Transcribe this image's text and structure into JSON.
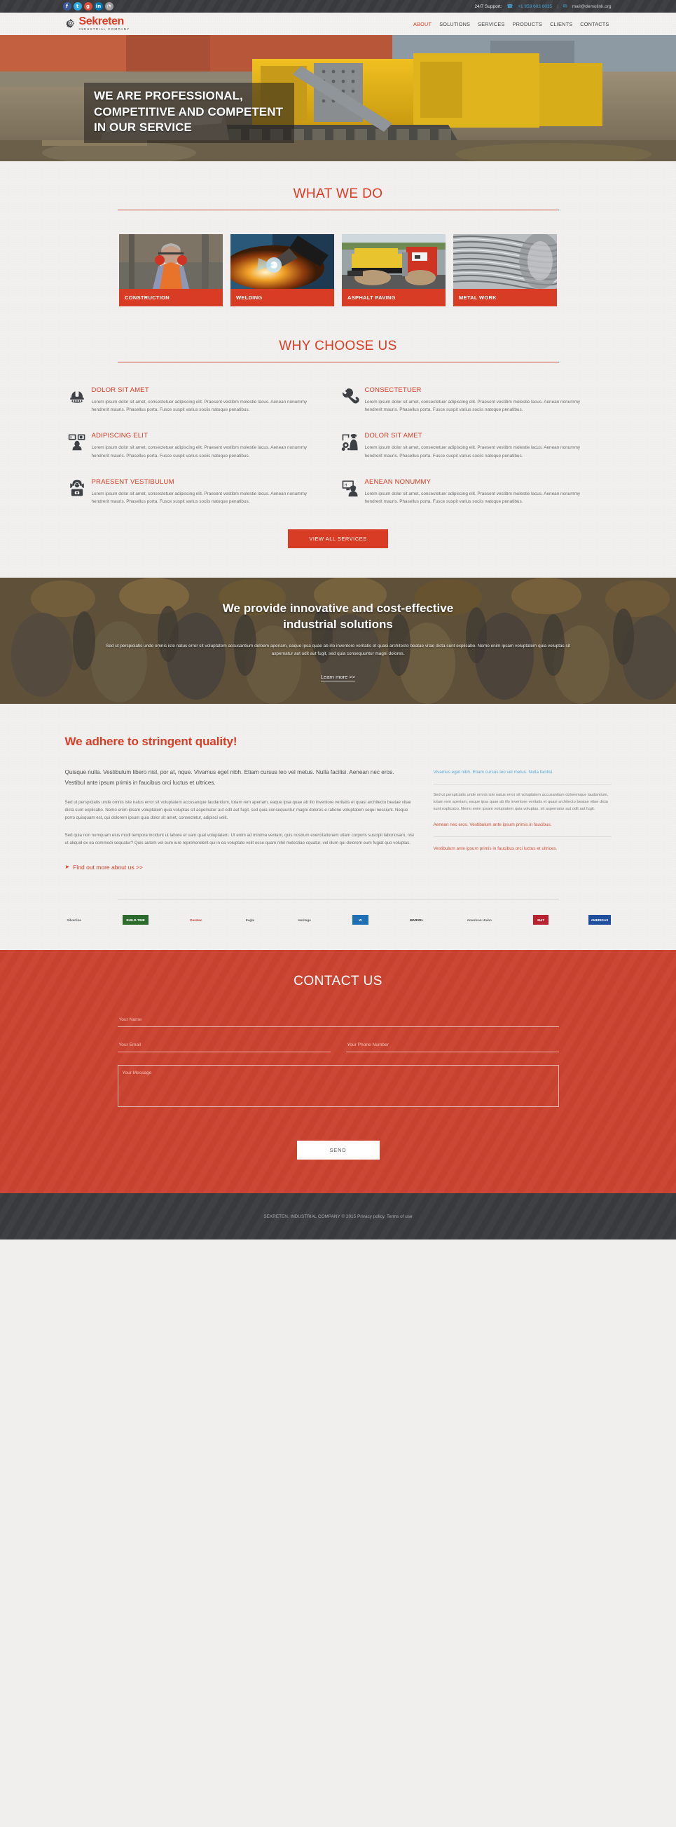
{
  "topbar": {
    "social": [
      {
        "name": "facebook",
        "glyph": "f"
      },
      {
        "name": "twitter",
        "glyph": "t"
      },
      {
        "name": "google-plus",
        "glyph": "g"
      },
      {
        "name": "linkedin",
        "glyph": "in"
      },
      {
        "name": "rss",
        "glyph": "◔"
      }
    ],
    "support_label": "24/7 Support:",
    "phone": "+1 959 603 6035",
    "separator": "|",
    "email": "mail@demolink.org"
  },
  "header": {
    "logo_name": "Sekreten",
    "logo_sub": "INDUSTRIAL COMPANY",
    "nav": [
      {
        "label": "ABOUT",
        "active": true
      },
      {
        "label": "SOLUTIONS",
        "active": false
      },
      {
        "label": "SERVICES",
        "active": false
      },
      {
        "label": "PRODUCTS",
        "active": false
      },
      {
        "label": "CLIENTS",
        "active": false
      },
      {
        "label": "CONTACTS",
        "active": false
      }
    ]
  },
  "hero": {
    "line1": "WE ARE PROFESSIONAL,",
    "line2": "COMPETITIVE AND COMPETENT",
    "line3": "IN OUR SERVICE"
  },
  "what_we_do": {
    "title": "WHAT WE DO",
    "cards": [
      {
        "label": "CONSTRUCTION"
      },
      {
        "label": "WELDING"
      },
      {
        "label": "ASPHALT PAVING"
      },
      {
        "label": "METAL WORK"
      }
    ]
  },
  "why_choose_us": {
    "title": "WHY CHOOSE US",
    "body": "Lorem ipsum dolor sit amet, consectetuer adipiscing elit. Praesent vestibm molestie lacus. Aenean nonummy hendrerit mauris. Phasellus porta. Fusce suspit varius sociis natoque penatibus.",
    "features": [
      {
        "title": "DOLOR SIT AMET",
        "icon": "hard-hat-icon"
      },
      {
        "title": "CONSECTETUER",
        "icon": "wrench-icon"
      },
      {
        "title": "ADIPISCING ELIT",
        "icon": "monitor-worker-icon"
      },
      {
        "title": "DOLOR SIT AMET",
        "icon": "crane-worker-icon"
      },
      {
        "title": "PRAESENT VESTIBULUM",
        "icon": "worker-laptop-icon"
      },
      {
        "title": "AENEAN NONUMMY",
        "icon": "screen-worker-icon"
      }
    ],
    "button": "VIEW ALL SERVICES"
  },
  "parallax": {
    "heading_line1": "We provide innovative and cost-effective",
    "heading_line2": "industrial solutions",
    "text": "Sed ut perspiciatis unde omnis iste natus error sit voluptatem accusantium doloem aperiam, eaque ipsa quae ab illo inventore veritatis et quasi architecto beatae vitae dicta sunt explicabo. Nemo enim ipsam voluptatem quia voluptas sit aspernatur aut odit aut fugit, sed quia consequuntur magni dolores.",
    "link": "Learn more >>"
  },
  "quality": {
    "heading": "We adhere to stringent quality!",
    "lead": "Quisque nulla. Vestibulum libero nisl, por at, nque. Vivamus eget nibh. Etiam cursus leo vel metus. Nulla facilisi. Aenean nec eros. Vestibul ante ipsum primis in faucibus orci luctus et ultrices.",
    "para1": "Sed ut perspiciatis unde omnis iste natus error sit voluptatem accusanque laudantium, totam rem aperiam, eaque ipsa quae ab illo inventore veritatis et quasi architecto beatae vitae dicta sunt explicabo. Nemo enim ipsam voluptatem quia voluptas sit aspematur aut odit aut fugit, sed quia consequuntur magni dolores e ratione voluptatem sequi nesciunt. Neque porro quisquam est, qui dolorem ipsum quia dolor sit amet, consectetur, adipisci velit.",
    "para2": "Sed quia non numquam eius modi tempora incidunt ut labore et uam quat voluptatem. Ut enim ad minima veniam, quis nostrum exercitationem ullam corporis suscipit laboriosam, nisi ut aliquid ex ea commodi sequatur? Quis autem vel eum iure reprehenderit qui in ea voluptate velit esse quam nihil molestiae cquatur, vel illum qui dolorem eum fugiat quo voluptas.",
    "side_blue": "Vivamus eget nibh. Etiam cursus leo vel metus. Nulla facilisi.",
    "side_gray": "Sed ut perspiciatis unde omnis iste natus error sit voluptatem accusantium doloremque laudantium, totam rem aperiam, eaque ipsa quae ab illo inventore veritatis et quasi architecto beatae vitae dicta sunt explicabo. Nemo enim ipsam voluptatem quia voluptas. sit aspematur aut odit aut fugit.",
    "side_red1": "Aenean nec eros. Vestibulum ante ipsum primis in faucibus.",
    "side_red2": "Vestibulum ante ipsum primis in faucibus orci luctus et ultrices.",
    "find_out": "Find out more about us >>"
  },
  "partners": [
    {
      "name": "Silverline"
    },
    {
      "name": "BUILD-TIME"
    },
    {
      "name": "Duratec"
    },
    {
      "name": "Eagle"
    },
    {
      "name": "Heritage"
    },
    {
      "name": "W"
    },
    {
      "name": "MARVEL"
    },
    {
      "name": "American Union"
    },
    {
      "name": "M&T"
    },
    {
      "name": "AMERIGAS"
    }
  ],
  "contact": {
    "title": "CONTACT US",
    "name_placeholder": "Your Name",
    "email_placeholder": "Your Email",
    "phone_placeholder": "Your Phone Number",
    "message_placeholder": "Your Message",
    "send_label": "SEND"
  },
  "footer": {
    "copyright": "SEKRETEN. INDUSTRIAL COMPANY © 2015",
    "privacy": "Privacy policy.",
    "terms": "Terms of use"
  },
  "colors": {
    "accent": "#d93c24",
    "contact_bg": "#cc4331",
    "dark": "#3a3c3f",
    "page_bg": "#f1f0ee"
  }
}
